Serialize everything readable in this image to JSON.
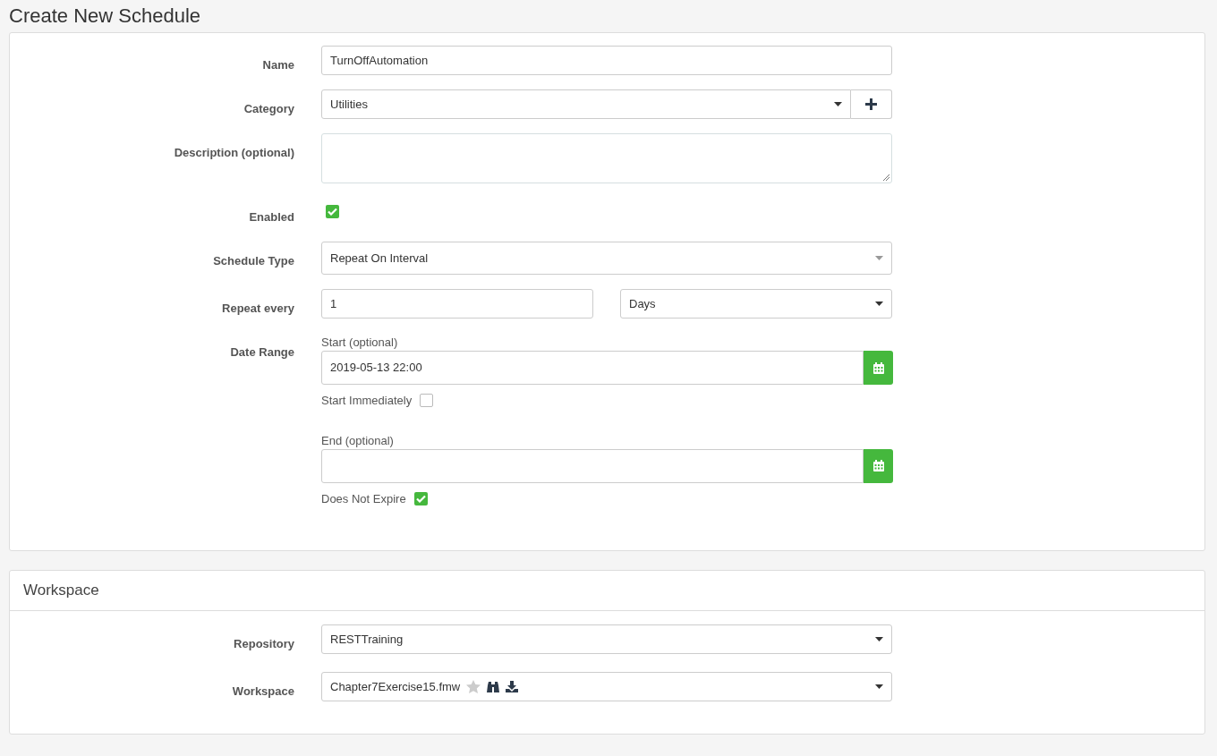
{
  "page_title": "Create New Schedule",
  "schedule_form": {
    "rows": [
      {
        "kind": "text",
        "label": "Name",
        "value": "TurnOffAutomation"
      },
      {
        "kind": "select_add",
        "label": "Category",
        "value": "Utilities"
      },
      {
        "kind": "textarea",
        "label": "Description (optional)"
      },
      {
        "kind": "checkbox",
        "label": "Enabled",
        "checked": true
      },
      {
        "kind": "combo",
        "label": "Schedule Type",
        "value": "Repeat On Interval"
      },
      {
        "kind": "interval",
        "label": "Repeat every",
        "value": "1",
        "unit": "Days"
      },
      {
        "kind": "date_range",
        "label": "Date Range",
        "start": {
          "label": "Start (optional)",
          "value": "2019-05-13 22:00",
          "option": "Start Immediately",
          "checked": false
        },
        "end": {
          "label": "End (optional)",
          "option": "Does Not Expire",
          "checked": true
        }
      }
    ]
  },
  "workspace_panel": {
    "title": "Workspace",
    "rows": [
      {
        "kind": "select",
        "label": "Repository",
        "value": "RESTTraining"
      },
      {
        "kind": "workspace_select",
        "label": "Workspace",
        "value": "Chapter7Exercise15.fmw"
      }
    ]
  }
}
